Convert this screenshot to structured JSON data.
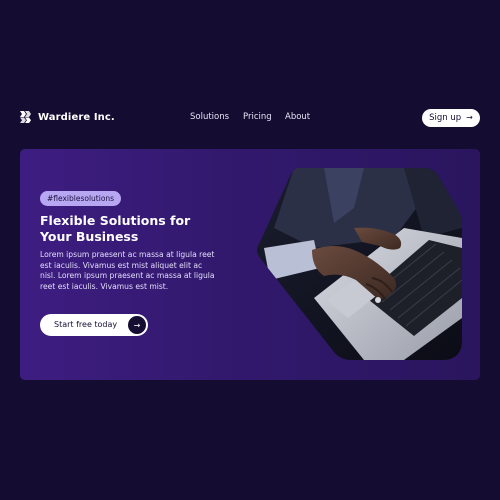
{
  "brand": {
    "name": "Wardiere Inc."
  },
  "nav": {
    "items": [
      {
        "label": "Solutions"
      },
      {
        "label": "Pricing"
      },
      {
        "label": "About"
      }
    ],
    "signup_label": "Sign up",
    "signup_icon": "arrow-right-icon"
  },
  "hero": {
    "tag": "#flexiblesolutions",
    "title_line1": "Flexible Solutions for",
    "title_line2": "Your Business",
    "body": "Lorem ipsum praesent ac massa at ligula reet est iaculis. Vivamus est mist aliquet elit ac nisl. Lorem ipsum praesent ac massa at ligula reet est iaculis. Vivamus est mist.",
    "cta_label": "Start free today",
    "cta_icon": "arrow-right-icon",
    "image_subject": "hands typing on laptop"
  },
  "colors": {
    "background": "#140c31",
    "card": "#3a1c7a",
    "tag_pill": "#b7a6f2",
    "button": "#ffffff",
    "button_text": "#160d33"
  }
}
